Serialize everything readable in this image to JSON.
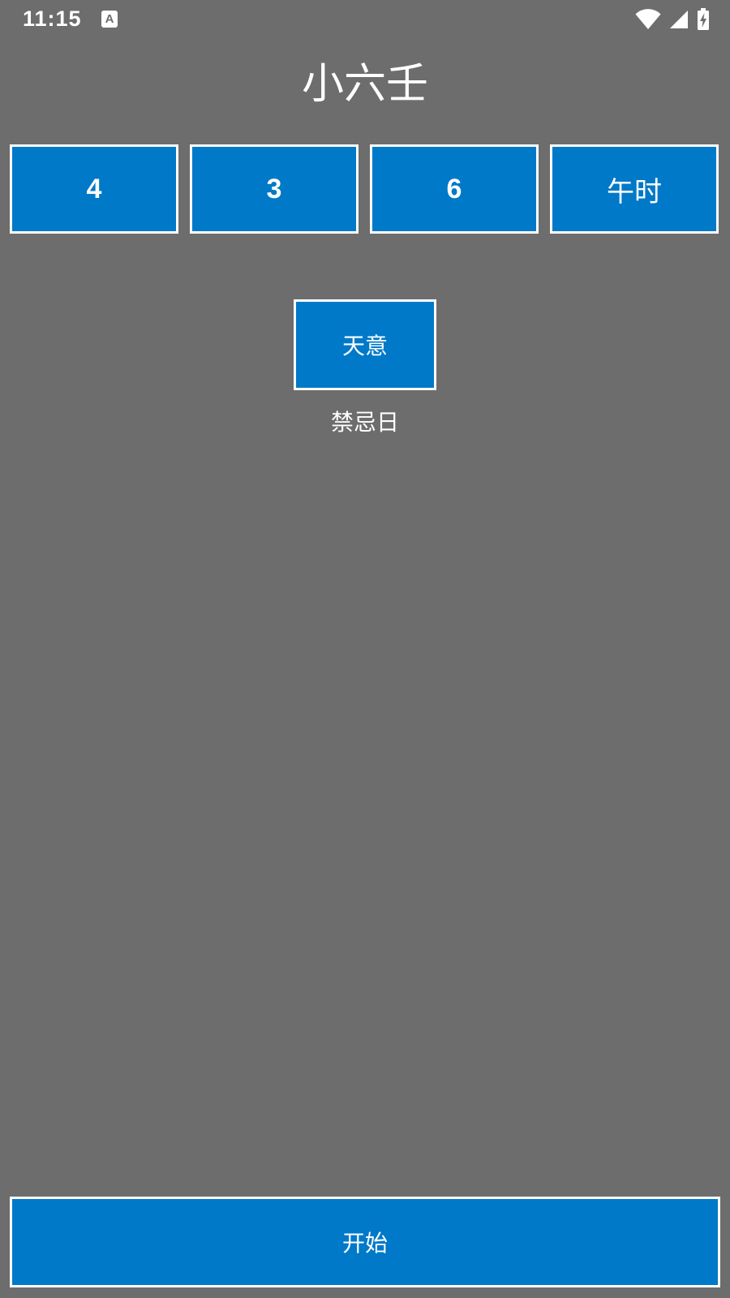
{
  "status_bar": {
    "time": "11:15",
    "icons": [
      "text-notification-icon",
      "wifi-icon",
      "cell-signal-icon",
      "battery-charging-icon"
    ]
  },
  "title": "小六壬",
  "values": {
    "first": "4",
    "second": "3",
    "third": "6",
    "hour": "午时"
  },
  "result": {
    "name": "天意",
    "description": "禁忌日"
  },
  "start_button": {
    "label": "开始"
  },
  "colors": {
    "background": "#6d6d6d",
    "box_fill": "#0079c9",
    "box_border": "#ffffff",
    "text": "#ffffff"
  }
}
